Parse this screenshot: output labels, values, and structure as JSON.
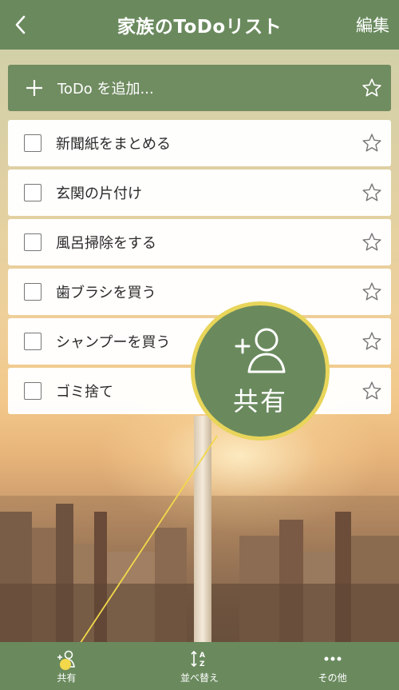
{
  "header": {
    "title": "家族のToDoリスト",
    "edit_label": "編集"
  },
  "add_row": {
    "label": "ToDo を追加..."
  },
  "tasks": [
    {
      "text": "新聞紙をまとめる"
    },
    {
      "text": "玄関の片付け"
    },
    {
      "text": "風呂掃除をする"
    },
    {
      "text": "歯ブラシを買う"
    },
    {
      "text": "シャンプーを買う"
    },
    {
      "text": "ゴミ捨て"
    }
  ],
  "callout": {
    "label": "共有"
  },
  "bottom_bar": {
    "share_label": "共有",
    "sort_label": "並べ替え",
    "more_label": "その他"
  },
  "colors": {
    "bar_green": "#6a8a5e",
    "highlight_yellow": "#e8d55a"
  },
  "icons": [
    "back-chevron-icon",
    "plus-icon",
    "star-icon",
    "add-person-icon",
    "sort-az-icon",
    "more-dots-icon"
  ]
}
